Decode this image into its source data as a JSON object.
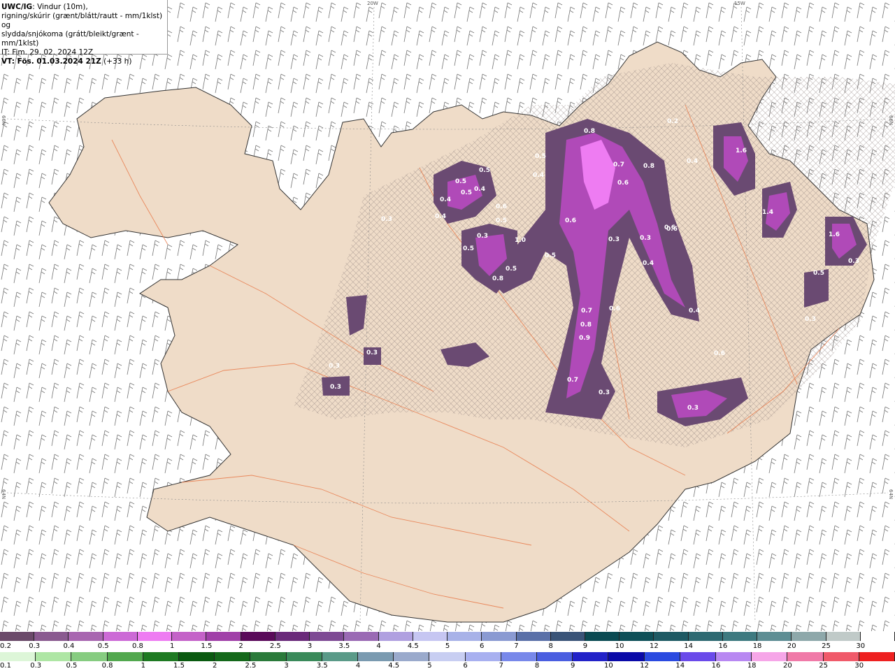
{
  "header": {
    "title_bold": "UWC/IG",
    "title_rest": ": Vindur (10m),",
    "line2": "rigning/skúrir (grænt/blátt/rautt - mm/1klst) og",
    "line3": "slydda/snjókoma (grátt/bleikt/grænt - mm/1klst)",
    "it_line": "IT: Fim. 29. 02. 2024 12Z",
    "vt_bold": "VT: Fös. 01.03.2024 21Z",
    "vt_rest": " (+33 h)"
  },
  "grid_labels": {
    "lon_20w": "20W",
    "lon_15w": "15W",
    "lat_66n_left": "66N",
    "lat_66n_right": "66N",
    "lat_64n_left": "64N",
    "lat_64n_right": "64N"
  },
  "precip_values": [
    "0.8",
    "0.2",
    "1.6",
    "0.5",
    "0.4",
    "0.7",
    "0.8",
    "0.4",
    "0.5",
    "0.6",
    "0.5",
    "0.4",
    "0.5",
    "0.4",
    "0.6",
    "1.4",
    "0.3",
    "0.4",
    "0.5",
    "0.6",
    "0.3",
    "0.3",
    "0.6",
    "1.6",
    "0.5",
    "1.0",
    "0.5",
    "0.3",
    "0.4",
    "0.5",
    "0.8",
    "0.3",
    "0.5",
    "0.4",
    "0.7",
    "0.6",
    "0.8",
    "0.9",
    "0.3",
    "0.3",
    "0.3",
    "0.7",
    "0.3",
    "0.6",
    "0.3",
    "0.6",
    "0.3"
  ],
  "colors": {
    "land": "#efdcc8",
    "roads": "#e87a4a",
    "snow_cloud_hatch": "#9a8a86",
    "precip_light": "#6a4a72",
    "precip_mid": "#b04ab8",
    "precip_heavy": "#ee7cf2"
  },
  "legend_snow": {
    "labels": [
      "0.2",
      "0.3",
      "0.4",
      "0.5",
      "0.8",
      "1",
      "1.5",
      "2",
      "2.5",
      "3",
      "3.5",
      "4",
      "4.5",
      "5",
      "6",
      "7",
      "8",
      "9",
      "10",
      "12",
      "14",
      "16",
      "18",
      "20",
      "25",
      "30"
    ],
    "colors": [
      "#6b4a6a",
      "#8a5a90",
      "#a866b0",
      "#cc6ad6",
      "#ee7cf2",
      "#c462c8",
      "#a040a8",
      "#5a0a5a",
      "#6a2a7a",
      "#7e4a94",
      "#9a6ab4",
      "#b0a0e0",
      "#c6c6f2",
      "#a8b2e8",
      "#8a9ad2",
      "#5a70a8",
      "#3a5478",
      "#0a4a52",
      "#0e5058",
      "#1e5a64",
      "#2e6a72",
      "#3e7a80",
      "#5e8e94",
      "#8ea8aa",
      "#c0cac8",
      "#ffffff"
    ]
  },
  "legend_rain": {
    "labels": [
      "0.1",
      "0.3",
      "0.5",
      "0.8",
      "1",
      "1.5",
      "2",
      "2.5",
      "3",
      "3.5",
      "4",
      "4.5",
      "5",
      "6",
      "7",
      "8",
      "9",
      "10",
      "12",
      "14",
      "16",
      "18",
      "20",
      "25",
      "30"
    ],
    "colors": [
      "#ddf6d8",
      "#aee6a4",
      "#86cc80",
      "#52a84e",
      "#1e7a22",
      "#0a5a10",
      "#14681a",
      "#2a7a3a",
      "#3a8a5a",
      "#5a9a88",
      "#7a9ab0",
      "#9aaacc",
      "#c8cef2",
      "#a8b0f0",
      "#7888ea",
      "#4a5ee0",
      "#2222c8",
      "#0a0aa8",
      "#2a4ae0",
      "#6a4aea",
      "#b888f2",
      "#f6a6e8",
      "#f07aa8",
      "#f05a6a",
      "#ee2020"
    ]
  }
}
